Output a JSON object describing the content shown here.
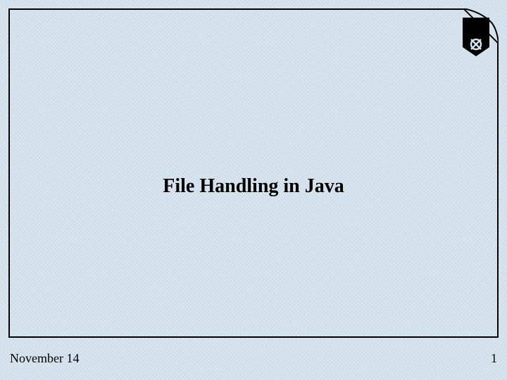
{
  "slide": {
    "title": "File Handling in Java"
  },
  "footer": {
    "date": "November 14",
    "page_number": "1"
  }
}
